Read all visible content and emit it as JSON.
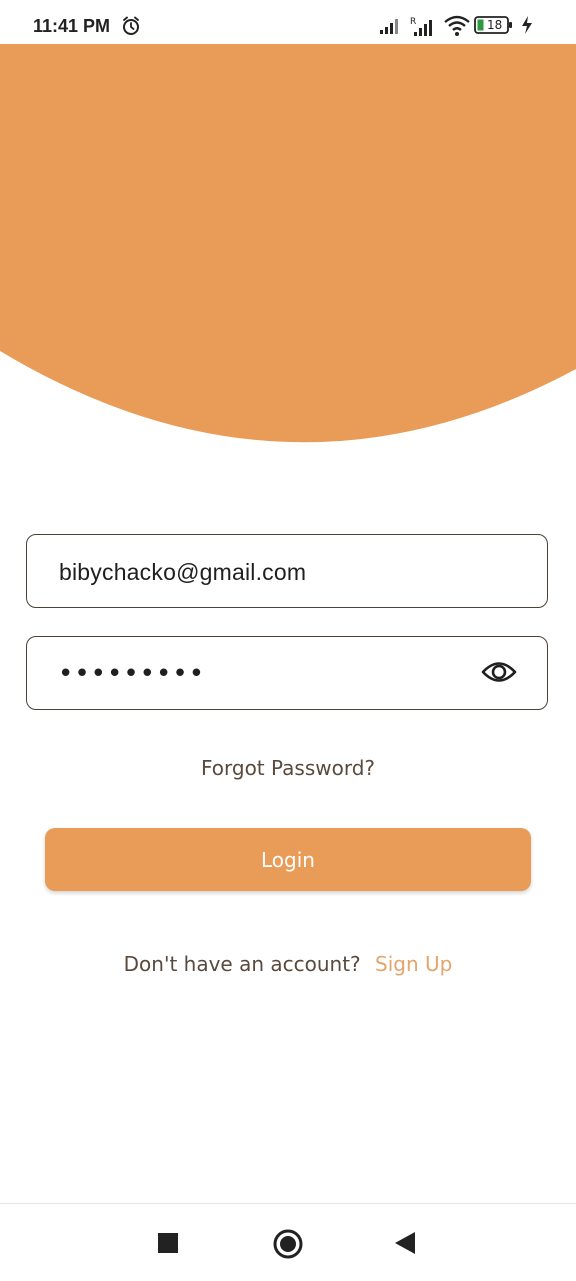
{
  "status_bar": {
    "time": "11:41 PM",
    "battery": "18",
    "icons": [
      "alarm-icon",
      "signal-icon",
      "signal-roaming-icon",
      "wifi-icon",
      "battery-icon",
      "charging-icon"
    ]
  },
  "colors": {
    "accent": "#E99C58",
    "link": "#E3A56C",
    "text_muted": "#5A4A3D",
    "border": "#4A4238"
  },
  "login_form": {
    "email_value": "bibychacko@gmail.com",
    "password_masked": "•••••••••",
    "visibility_icon": "eye-icon",
    "forgot_label": "Forgot Password?",
    "login_label": "Login",
    "signup_prompt": "Don't have an account?",
    "signup_label": "Sign Up"
  },
  "nav_bar": {
    "icons": [
      "recent-apps-icon",
      "home-icon",
      "back-icon"
    ]
  }
}
